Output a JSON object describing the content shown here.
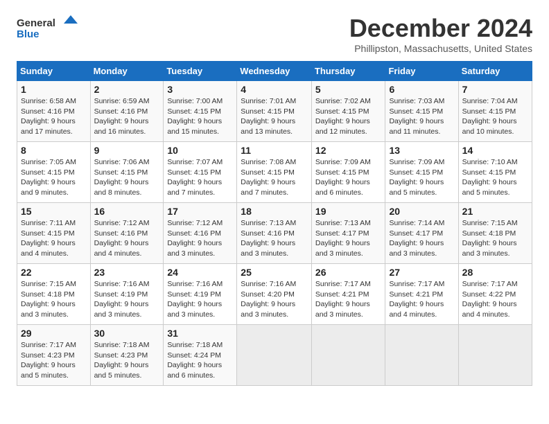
{
  "header": {
    "logo_line1": "General",
    "logo_line2": "Blue",
    "title": "December 2024",
    "subtitle": "Phillipston, Massachusetts, United States"
  },
  "weekdays": [
    "Sunday",
    "Monday",
    "Tuesday",
    "Wednesday",
    "Thursday",
    "Friday",
    "Saturday"
  ],
  "weeks": [
    [
      {
        "day": "1",
        "info": "Sunrise: 6:58 AM\nSunset: 4:16 PM\nDaylight: 9 hours\nand 17 minutes."
      },
      {
        "day": "2",
        "info": "Sunrise: 6:59 AM\nSunset: 4:16 PM\nDaylight: 9 hours\nand 16 minutes."
      },
      {
        "day": "3",
        "info": "Sunrise: 7:00 AM\nSunset: 4:15 PM\nDaylight: 9 hours\nand 15 minutes."
      },
      {
        "day": "4",
        "info": "Sunrise: 7:01 AM\nSunset: 4:15 PM\nDaylight: 9 hours\nand 13 minutes."
      },
      {
        "day": "5",
        "info": "Sunrise: 7:02 AM\nSunset: 4:15 PM\nDaylight: 9 hours\nand 12 minutes."
      },
      {
        "day": "6",
        "info": "Sunrise: 7:03 AM\nSunset: 4:15 PM\nDaylight: 9 hours\nand 11 minutes."
      },
      {
        "day": "7",
        "info": "Sunrise: 7:04 AM\nSunset: 4:15 PM\nDaylight: 9 hours\nand 10 minutes."
      }
    ],
    [
      {
        "day": "8",
        "info": "Sunrise: 7:05 AM\nSunset: 4:15 PM\nDaylight: 9 hours\nand 9 minutes."
      },
      {
        "day": "9",
        "info": "Sunrise: 7:06 AM\nSunset: 4:15 PM\nDaylight: 9 hours\nand 8 minutes."
      },
      {
        "day": "10",
        "info": "Sunrise: 7:07 AM\nSunset: 4:15 PM\nDaylight: 9 hours\nand 7 minutes."
      },
      {
        "day": "11",
        "info": "Sunrise: 7:08 AM\nSunset: 4:15 PM\nDaylight: 9 hours\nand 7 minutes."
      },
      {
        "day": "12",
        "info": "Sunrise: 7:09 AM\nSunset: 4:15 PM\nDaylight: 9 hours\nand 6 minutes."
      },
      {
        "day": "13",
        "info": "Sunrise: 7:09 AM\nSunset: 4:15 PM\nDaylight: 9 hours\nand 5 minutes."
      },
      {
        "day": "14",
        "info": "Sunrise: 7:10 AM\nSunset: 4:15 PM\nDaylight: 9 hours\nand 5 minutes."
      }
    ],
    [
      {
        "day": "15",
        "info": "Sunrise: 7:11 AM\nSunset: 4:15 PM\nDaylight: 9 hours\nand 4 minutes."
      },
      {
        "day": "16",
        "info": "Sunrise: 7:12 AM\nSunset: 4:16 PM\nDaylight: 9 hours\nand 4 minutes."
      },
      {
        "day": "17",
        "info": "Sunrise: 7:12 AM\nSunset: 4:16 PM\nDaylight: 9 hours\nand 3 minutes."
      },
      {
        "day": "18",
        "info": "Sunrise: 7:13 AM\nSunset: 4:16 PM\nDaylight: 9 hours\nand 3 minutes."
      },
      {
        "day": "19",
        "info": "Sunrise: 7:13 AM\nSunset: 4:17 PM\nDaylight: 9 hours\nand 3 minutes."
      },
      {
        "day": "20",
        "info": "Sunrise: 7:14 AM\nSunset: 4:17 PM\nDaylight: 9 hours\nand 3 minutes."
      },
      {
        "day": "21",
        "info": "Sunrise: 7:15 AM\nSunset: 4:18 PM\nDaylight: 9 hours\nand 3 minutes."
      }
    ],
    [
      {
        "day": "22",
        "info": "Sunrise: 7:15 AM\nSunset: 4:18 PM\nDaylight: 9 hours\nand 3 minutes."
      },
      {
        "day": "23",
        "info": "Sunrise: 7:16 AM\nSunset: 4:19 PM\nDaylight: 9 hours\nand 3 minutes."
      },
      {
        "day": "24",
        "info": "Sunrise: 7:16 AM\nSunset: 4:19 PM\nDaylight: 9 hours\nand 3 minutes."
      },
      {
        "day": "25",
        "info": "Sunrise: 7:16 AM\nSunset: 4:20 PM\nDaylight: 9 hours\nand 3 minutes."
      },
      {
        "day": "26",
        "info": "Sunrise: 7:17 AM\nSunset: 4:21 PM\nDaylight: 9 hours\nand 3 minutes."
      },
      {
        "day": "27",
        "info": "Sunrise: 7:17 AM\nSunset: 4:21 PM\nDaylight: 9 hours\nand 4 minutes."
      },
      {
        "day": "28",
        "info": "Sunrise: 7:17 AM\nSunset: 4:22 PM\nDaylight: 9 hours\nand 4 minutes."
      }
    ],
    [
      {
        "day": "29",
        "info": "Sunrise: 7:17 AM\nSunset: 4:23 PM\nDaylight: 9 hours\nand 5 minutes."
      },
      {
        "day": "30",
        "info": "Sunrise: 7:18 AM\nSunset: 4:23 PM\nDaylight: 9 hours\nand 5 minutes."
      },
      {
        "day": "31",
        "info": "Sunrise: 7:18 AM\nSunset: 4:24 PM\nDaylight: 9 hours\nand 6 minutes."
      },
      null,
      null,
      null,
      null
    ]
  ]
}
